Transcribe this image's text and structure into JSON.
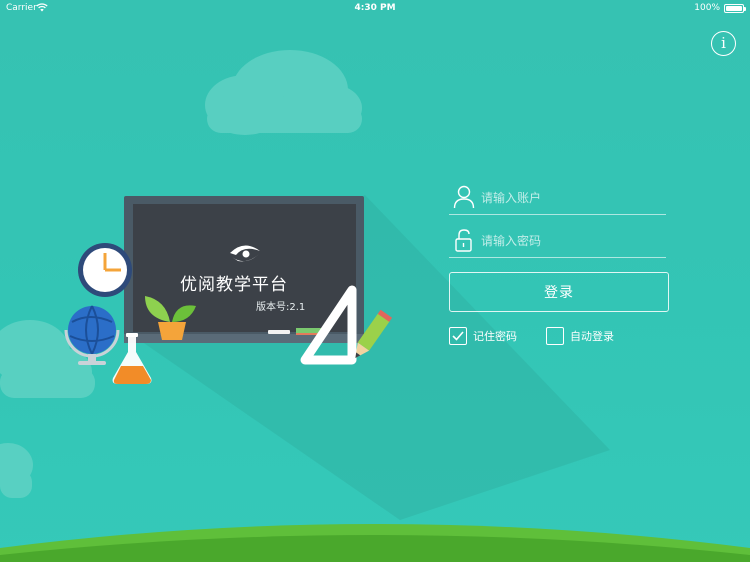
{
  "status_bar": {
    "carrier": "Carrier",
    "time": "4:30 PM",
    "battery": "100%"
  },
  "info_button": {
    "label": "i"
  },
  "brand": {
    "title": "优阅教学平台",
    "version": "版本号:2.1"
  },
  "login_form": {
    "account_placeholder": "请输入账户",
    "password_placeholder": "请输入密码",
    "login_label": "登录",
    "remember_label": "记住密码",
    "remember_checked": true,
    "auto_login_label": "自动登录",
    "auto_login_checked": false
  },
  "colors": {
    "background": "#35c3b3",
    "grass": "#5fbf3a",
    "chalkboard": "#3c4148",
    "chalkboard_frame": "#4a5a66"
  },
  "icons": [
    "wifi-icon",
    "battery-icon",
    "info-icon",
    "user-icon",
    "lock-icon",
    "checkmark-icon",
    "clock-icon",
    "globe-icon",
    "flask-icon",
    "plant-icon",
    "triangle-ruler-icon",
    "pencil-icon",
    "eye-logo-icon"
  ]
}
